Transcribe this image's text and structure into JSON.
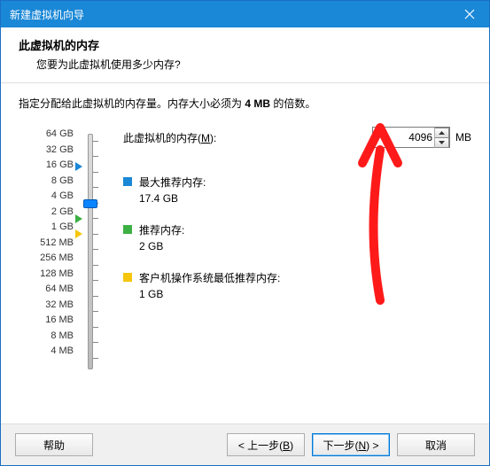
{
  "titlebar": {
    "title": "新建虚拟机向导"
  },
  "header": {
    "title": "此虚拟机的内存",
    "subtitle": "您要为此虚拟机使用多少内存?"
  },
  "description": {
    "prefix": "指定分配给此虚拟机的内存量。内存大小必须为 ",
    "bold": "4 MB",
    "suffix": " 的倍数。"
  },
  "memory": {
    "label_prefix": "此虚拟机的内存(",
    "label_key": "M",
    "label_suffix": "):",
    "value": "4096",
    "unit": "MB",
    "scale": [
      "64 GB",
      "32 GB",
      "16 GB",
      "8 GB",
      "4 GB",
      "2 GB",
      "1 GB",
      "512 MB",
      "256 MB",
      "128 MB",
      "64 MB",
      "32 MB",
      "16 MB",
      "8 MB",
      "4 MB"
    ]
  },
  "legend": {
    "max": {
      "label": "最大推荐内存:",
      "value": "17.4 GB"
    },
    "rec": {
      "label": "推荐内存:",
      "value": "2 GB"
    },
    "min": {
      "label": "客户机操作系统最低推荐内存:",
      "value": "1 GB"
    }
  },
  "buttons": {
    "help": "帮助",
    "back_pre": "< 上一步(",
    "back_key": "B",
    "back_suf": ")",
    "next_pre": "下一步(",
    "next_key": "N",
    "next_suf": ") >",
    "cancel": "取消"
  }
}
